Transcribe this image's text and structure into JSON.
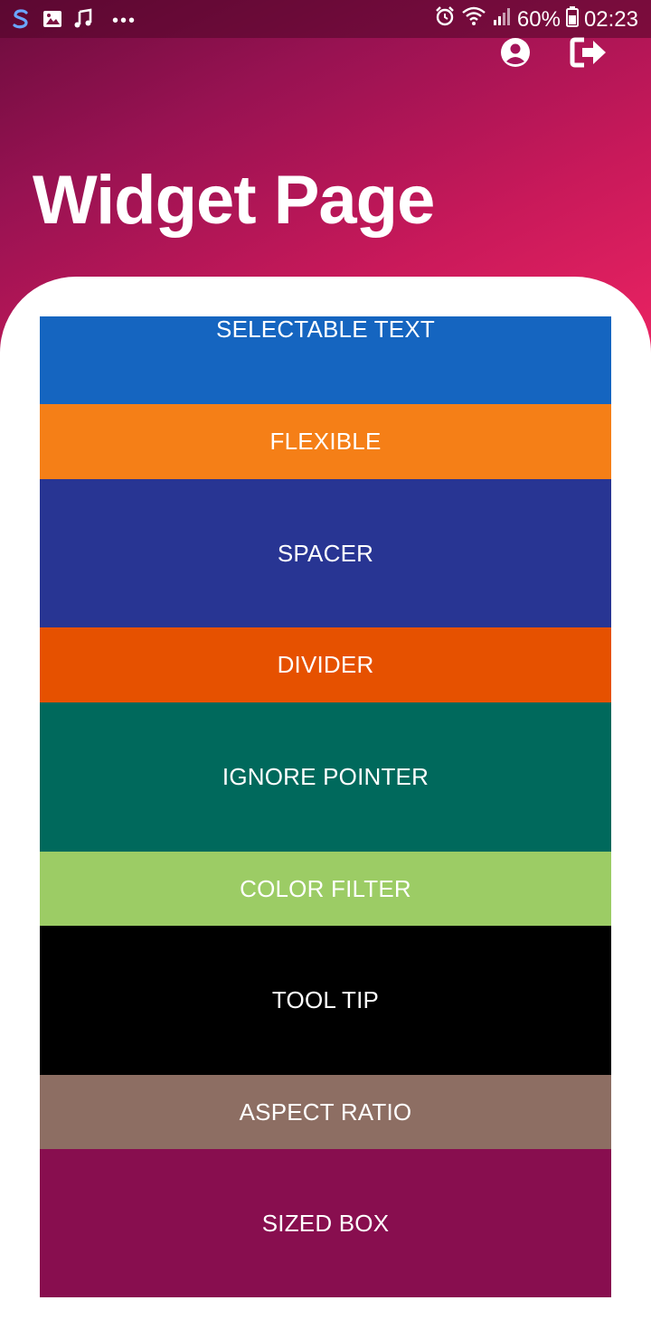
{
  "status_bar": {
    "battery": "60%",
    "time": "02:23",
    "left_icons": [
      "s-browser-icon",
      "image-icon",
      "music-note-icon",
      "more-dots-icon"
    ],
    "right_icons": [
      "alarm-icon",
      "wifi-icon",
      "signal-icon",
      "battery-icon"
    ]
  },
  "header": {
    "title": "Widget Page",
    "actions": [
      "account-icon",
      "logout-icon"
    ]
  },
  "items": [
    {
      "label": "SELECTABLE TEXT",
      "color": "#1565c0"
    },
    {
      "label": "FLEXIBLE",
      "color": "#f57f17"
    },
    {
      "label": "SPACER",
      "color": "#283593"
    },
    {
      "label": "DIVIDER",
      "color": "#e65100"
    },
    {
      "label": "IGNORE POINTER",
      "color": "#00695c"
    },
    {
      "label": "COLOR FILTER",
      "color": "#9ccc65"
    },
    {
      "label": "TOOL TIP",
      "color": "#000000"
    },
    {
      "label": "ASPECT RATIO",
      "color": "#8d6e63"
    },
    {
      "label": "SIZED BOX",
      "color": "#880e4f"
    }
  ],
  "theme": {
    "gradient_start": "#6b0c3d",
    "gradient_end": "#ee2463"
  }
}
